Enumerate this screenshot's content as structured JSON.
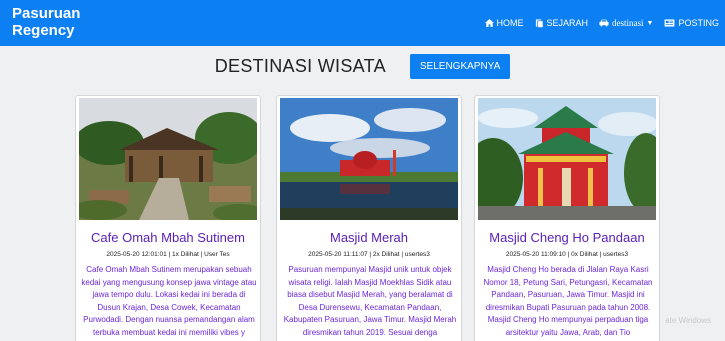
{
  "brand": "Pasuruan Regency",
  "nav": [
    {
      "label": "HOME",
      "icon": "home-icon"
    },
    {
      "label": "SEJARAH",
      "icon": "book-icon"
    },
    {
      "label": "destinasi",
      "icon": "car-icon"
    },
    {
      "label": "POSTING",
      "icon": "newspaper-icon"
    }
  ],
  "section": {
    "title": "DESTINASI WISATA",
    "button": "SELENGKAPNYA"
  },
  "cards": [
    {
      "title": "Cafe Omah Mbah Sutinem",
      "meta": "2025-05-20 12:01:01 | 1x Dilihat | User Tes",
      "desc": "Cafe Omah Mbah Sutinem merupakan sebuah kedai yang mengusung konsep jawa vintage atau jawa tempo dulu. Lokasi kedai ini berada di Dusun Krajan, Desa Cowek, Kecamatan Purwodadi. Dengan nuansa pemandangan alam terbuka membuat kedai ini memiliki vibes y"
    },
    {
      "title": "Masjid Merah",
      "meta": "2025-05-20 11:11:07 | 2x Dilihat | usertes3",
      "desc": "Pasuruan mempunyai Masjid unik untuk objek wisata religi. Ialah Masjid Moekhlas Sidik atau biasa disebut Masjid Merah, yang beralamat di Desa Durensewu, Kecamatan Pandaan, Kabupaten Pasuruan, Jawa Timur. Masjid Merah diresmikan tahun 2019. Sesuai denga"
    },
    {
      "title": "Masjid Cheng Ho Pandaan",
      "meta": "2025-05-20 11:09:10 | 0x Dilihat | usertes3",
      "desc": "Masjid Cheng Ho berada di Jlalan Raya Kasri Nomor 18, Petung Sari, Petungasri, Kecamatan Pandaan, Pasuruan, Jawa Timur. Masjid ini diresmikan Bupati Pasuruan pada tahun 2008. Masjid Cheng Ho mempunyai perpaduan tiga arsitektur yaitu Jawa, Arab, dan Tio"
    }
  ],
  "watermark": "ate Windows"
}
